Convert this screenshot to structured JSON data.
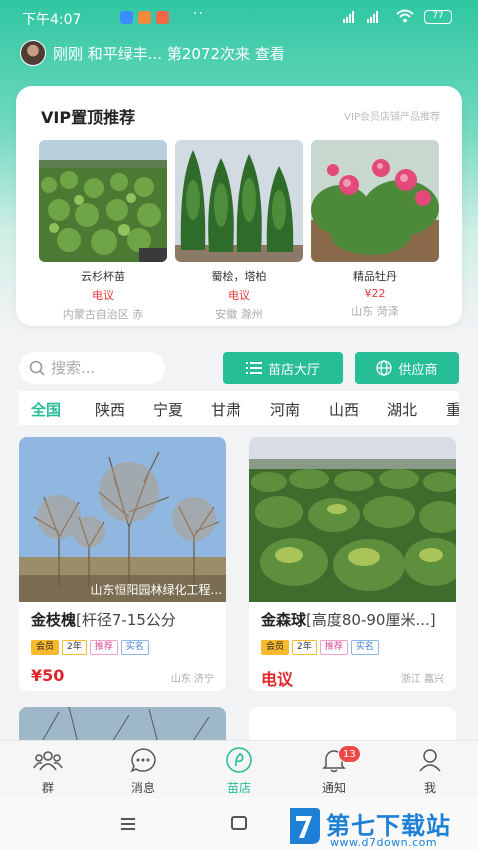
{
  "status_bar": {
    "time": "下午4:07",
    "battery": "77"
  },
  "visitor_bar": {
    "text": "刚刚 和平绿丰... 第2072次来 查看"
  },
  "vip": {
    "title": "VIP置顶推荐",
    "subtitle": "VIP会员店铺产品推荐",
    "items": [
      {
        "name": "云杉杯苗",
        "price": "电议",
        "location": "内蒙古自治区 赤"
      },
      {
        "name": "蜀桧，塔柏",
        "price": "电议",
        "location": "安徽 滁州"
      },
      {
        "name": "精品牡丹",
        "price": "¥22",
        "location": "山东 菏泽"
      }
    ]
  },
  "search": {
    "placeholder": "搜索..."
  },
  "buttons": {
    "nursery_hall": "苗店大厅",
    "supplier": "供应商"
  },
  "province_tabs": [
    "全国",
    "陕西",
    "宁夏",
    "甘肃",
    "河南",
    "山西",
    "湖北",
    "重"
  ],
  "products": [
    {
      "image_caption": "山东恒阳园林绿化工程...",
      "name": "金枝槐",
      "spec": "[杆径7-15公分",
      "badges": {
        "member": "会员",
        "years": "2年",
        "recommend": "推荐",
        "verified": "实名"
      },
      "price": "¥50",
      "location": "山东 济宁"
    },
    {
      "image_caption": "",
      "name": "金森球",
      "spec": "[高度80-90厘米...]",
      "badges": {
        "member": "会员",
        "years": "2年",
        "recommend": "推荐",
        "verified": "实名"
      },
      "price": "电议",
      "location": "浙江 嘉兴"
    }
  ],
  "bottom_nav": [
    {
      "label": "群",
      "icon": "group-icon"
    },
    {
      "label": "消息",
      "icon": "message-icon"
    },
    {
      "label": "苗店",
      "icon": "shop-icon"
    },
    {
      "label": "通知",
      "icon": "bell-icon",
      "badge": "13"
    },
    {
      "label": "我",
      "icon": "profile-icon"
    }
  ],
  "watermark": {
    "title": "第七下载站",
    "url": "www.d7down.com"
  },
  "colors": {
    "accent": "#26bd97",
    "price_red": "#e0262b",
    "member_gold": "#f7b92d"
  }
}
